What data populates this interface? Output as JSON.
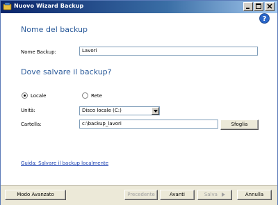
{
  "window": {
    "title": "Nuovo Wizard Backup"
  },
  "icons": {
    "app": "backup-app-icon",
    "help": "help-icon",
    "minimize": "minimize-icon",
    "maximize": "maximize-icon",
    "close": "close-icon"
  },
  "colors": {
    "heading": "#2a5a9a",
    "titlebar_start": "#0a246a",
    "titlebar_end": "#a6caf0",
    "link": "#1a3fb0"
  },
  "section_name": {
    "heading": "Nome del backup",
    "label": "Nome Backup:",
    "value": "Lavori"
  },
  "section_location": {
    "heading": "Dove salvare il backup?",
    "radios": [
      {
        "label": "Locale",
        "checked": true
      },
      {
        "label": "Rete",
        "checked": false
      }
    ],
    "drive_label": "Unità:",
    "drive_value": "Disco locale (C:)",
    "folder_label": "Cartella:",
    "folder_value": "c:\\backup_lavori",
    "browse_button": "Sfoglia"
  },
  "help_link": "Guida: Salvare il backup localmente",
  "footer": {
    "advanced": "Modo Avanzato",
    "previous": "Precedente",
    "next": "Avanti",
    "save": "Salva",
    "cancel": "Annulla"
  }
}
